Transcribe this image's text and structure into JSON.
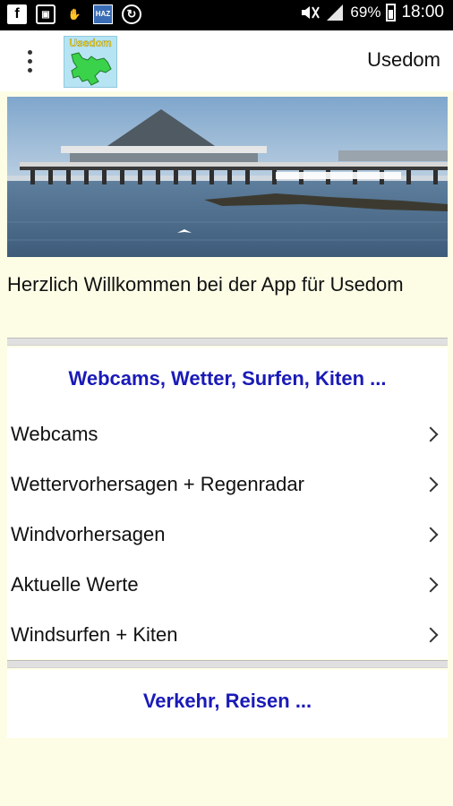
{
  "statusbar": {
    "icons": [
      "facebook-icon",
      "screenshot-icon",
      "hand-icon",
      "haz-icon",
      "sync-icon",
      "mute-icon",
      "signal-icon",
      "battery-icon"
    ],
    "haz_label": "HAZ",
    "battery": "69%",
    "time": "18:00"
  },
  "appbar": {
    "logo_text": "Usedom",
    "title": "Usedom"
  },
  "welcome": "Herzlich Willkommen bei der App für Usedom",
  "section1": {
    "header": "Webcams, Wetter, Surfen, Kiten ...",
    "items": [
      {
        "label": "Webcams"
      },
      {
        "label": "Wettervorhersagen + Regenradar"
      },
      {
        "label": "Windvorhersagen"
      },
      {
        "label": "Aktuelle Werte"
      },
      {
        "label": "Windsurfen + Kiten"
      }
    ]
  },
  "section2": {
    "header": "Verkehr, Reisen ..."
  },
  "colors": {
    "background": "#fdfde6",
    "section_header": "#1a1ab8"
  }
}
